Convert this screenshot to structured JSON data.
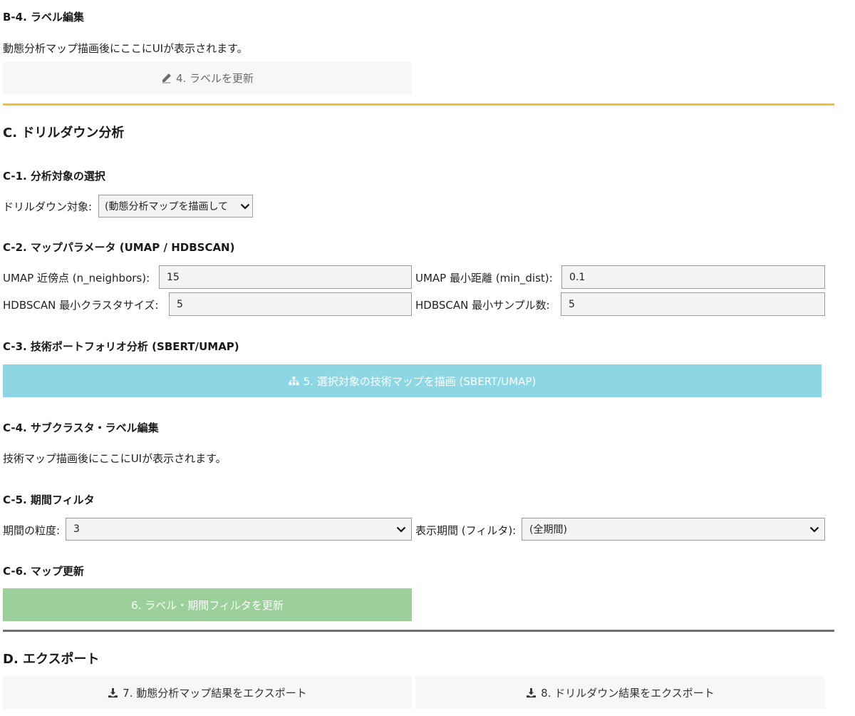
{
  "b4": {
    "heading": "B-4. ラベル編集",
    "placeholder_text": "動態分析マップ描画後にここにUIが表示されます。",
    "update_button": "4. ラベルを更新"
  },
  "c": {
    "heading": "C. ドリルダウン分析",
    "c1": {
      "heading": "C-1. 分析対象の選択",
      "target_label": "ドリルダウン対象:",
      "target_value": "(動態分析マップを描画して"
    },
    "c2": {
      "heading": "C-2. マップパラメータ (UMAP / HDBSCAN)",
      "n_neighbors_label": "UMAP 近傍点 (n_neighbors):",
      "n_neighbors_value": "15",
      "min_dist_label": "UMAP 最小距離 (min_dist):",
      "min_dist_value": "0.1",
      "min_cluster_label": "HDBSCAN 最小クラスタサイズ:",
      "min_cluster_value": "5",
      "min_samples_label": "HDBSCAN 最小サンプル数:",
      "min_samples_value": "5"
    },
    "c3": {
      "heading": "C-3. 技術ポートフォリオ分析 (SBERT/UMAP)",
      "draw_button": "5. 選択対象の技術マップを描画 (SBERT/UMAP)"
    },
    "c4": {
      "heading": "C-4. サブクラスタ・ラベル編集",
      "placeholder_text": "技術マップ描画後にここにUIが表示されます。"
    },
    "c5": {
      "heading": "C-5. 期間フィルタ",
      "granularity_label": "期間の粒度:",
      "granularity_value": "3",
      "period_label": "表示期間 (フィルタ):",
      "period_value": "(全期間)"
    },
    "c6": {
      "heading": "C-6. マップ更新",
      "update_button": "6. ラベル・期間フィルタを更新"
    }
  },
  "d": {
    "heading": "D. エクスポート",
    "export_dynamic_button": "7. 動態分析マップ結果をエクスポート",
    "export_drilldown_button": "8. ドリルダウン結果をエクスポート"
  },
  "colors": {
    "section_rule_c": "#f3c12d",
    "section_rule_d": "#6c6f78",
    "info_button": "#8dd7e4",
    "success_button": "#9bd09b"
  },
  "icons": {
    "update_labels": "pencil-icon",
    "draw_map": "sitemap-icon",
    "export": "download-icon",
    "select": "chevron-down-icon"
  }
}
